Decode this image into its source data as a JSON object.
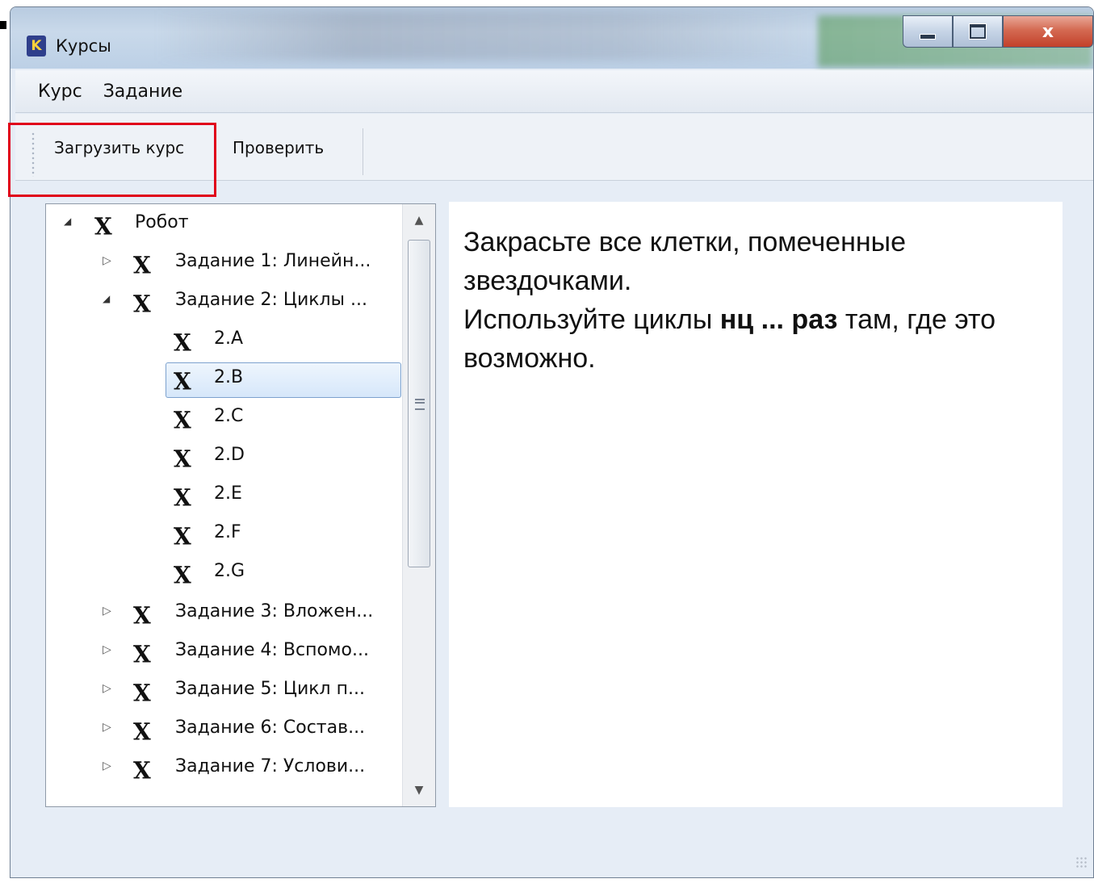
{
  "window": {
    "title": "Курсы",
    "app_icon_letter": "K",
    "controls": {
      "minimize": "",
      "maximize": "",
      "close": "x"
    }
  },
  "menu": {
    "items": [
      "Курс",
      "Задание"
    ]
  },
  "toolbar": {
    "load_label": "Загрузить курс",
    "check_label": "Проверить"
  },
  "highlight_color": "#e0001a",
  "tree": {
    "mark_glyph": "X",
    "expanded_glyph": "◢",
    "collapsed_glyph": "▷",
    "scroll_up": "▲",
    "scroll_down": "▼",
    "items": [
      {
        "label": "Робот"
      },
      {
        "label": "Задание 1: Линейн..."
      },
      {
        "label": "Задание 2: Циклы ..."
      },
      {
        "label": "2.A"
      },
      {
        "label": "2.B"
      },
      {
        "label": "2.C"
      },
      {
        "label": "2.D"
      },
      {
        "label": "2.E"
      },
      {
        "label": "2.F"
      },
      {
        "label": "2.G"
      },
      {
        "label": "Задание 3: Вложен..."
      },
      {
        "label": "Задание 4: Вспомо..."
      },
      {
        "label": "Задание 5: Цикл п..."
      },
      {
        "label": "Задание 6: Состав..."
      },
      {
        "label": "Задание 7: Услови..."
      }
    ],
    "selected": "2.B"
  },
  "task": {
    "line1": "Закрасьте все клетки, помеченные звездочками.",
    "line2_before": "Используйте циклы ",
    "line2_bold": "нц ... раз",
    "line2_after": " там, где это возможно."
  }
}
